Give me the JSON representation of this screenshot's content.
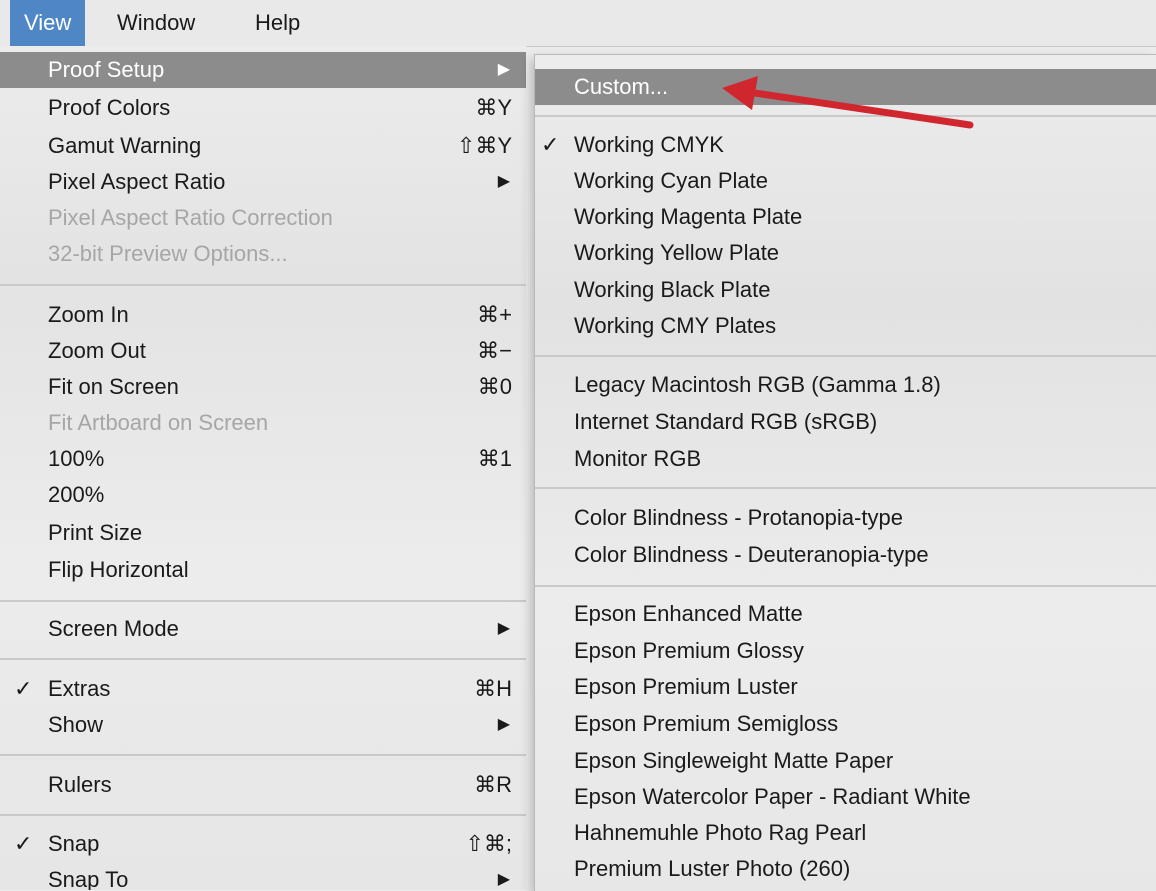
{
  "menubar": {
    "items": [
      "View",
      "Window",
      "Help"
    ]
  },
  "view_menu": {
    "proof_setup": "Proof Setup",
    "proof_colors": "Proof Colors",
    "proof_colors_sc": "⌘Y",
    "gamut_warning": "Gamut Warning",
    "gamut_warning_sc": "⇧⌘Y",
    "pixel_aspect_ratio": "Pixel Aspect Ratio",
    "pixel_aspect_ratio_correction": "Pixel Aspect Ratio Correction",
    "preview_options": "32-bit Preview Options...",
    "zoom_in": "Zoom In",
    "zoom_in_sc": "⌘+",
    "zoom_out": "Zoom Out",
    "zoom_out_sc": "⌘−",
    "fit_on_screen": "Fit on Screen",
    "fit_on_screen_sc": "⌘0",
    "fit_artboard": "Fit Artboard on Screen",
    "p100": "100%",
    "p100_sc": "⌘1",
    "p200": "200%",
    "print_size": "Print Size",
    "flip_horizontal": "Flip Horizontal",
    "screen_mode": "Screen Mode",
    "extras": "Extras",
    "extras_sc": "⌘H",
    "show": "Show",
    "rulers": "Rulers",
    "rulers_sc": "⌘R",
    "snap": "Snap",
    "snap_sc": "⇧⌘;",
    "snap_to": "Snap To",
    "check_glyph": "✓",
    "submenu_arrow": "▶"
  },
  "proof_submenu": {
    "custom": "Custom...",
    "working_cmyk": "Working CMYK",
    "working_cyan": "Working Cyan Plate",
    "working_magenta": "Working Magenta Plate",
    "working_yellow": "Working Yellow Plate",
    "working_black": "Working Black Plate",
    "working_cmy": "Working CMY Plates",
    "legacy_mac": "Legacy Macintosh RGB (Gamma 1.8)",
    "internet_srgb": "Internet Standard RGB (sRGB)",
    "monitor_rgb": "Monitor RGB",
    "protanopia": "Color Blindness - Protanopia-type",
    "deuteranopia": "Color Blindness - Deuteranopia-type",
    "epson_enhanced_matte": "Epson Enhanced Matte",
    "epson_premium_glossy": "Epson Premium Glossy",
    "epson_premium_luster": "Epson Premium Luster",
    "epson_premium_semigloss": "Epson Premium Semigloss",
    "epson_singleweight": "Epson Singleweight Matte Paper",
    "epson_watercolor": "Epson Watercolor Paper - Radiant White",
    "hahnemuhle": "Hahnemuhle Photo Rag Pearl",
    "premium_luster_260": "Premium Luster Photo  (260)"
  },
  "colors": {
    "menubar_active": "#4f86c6",
    "highlight": "#8c8c8c",
    "annotation_arrow": "#d0272e"
  }
}
